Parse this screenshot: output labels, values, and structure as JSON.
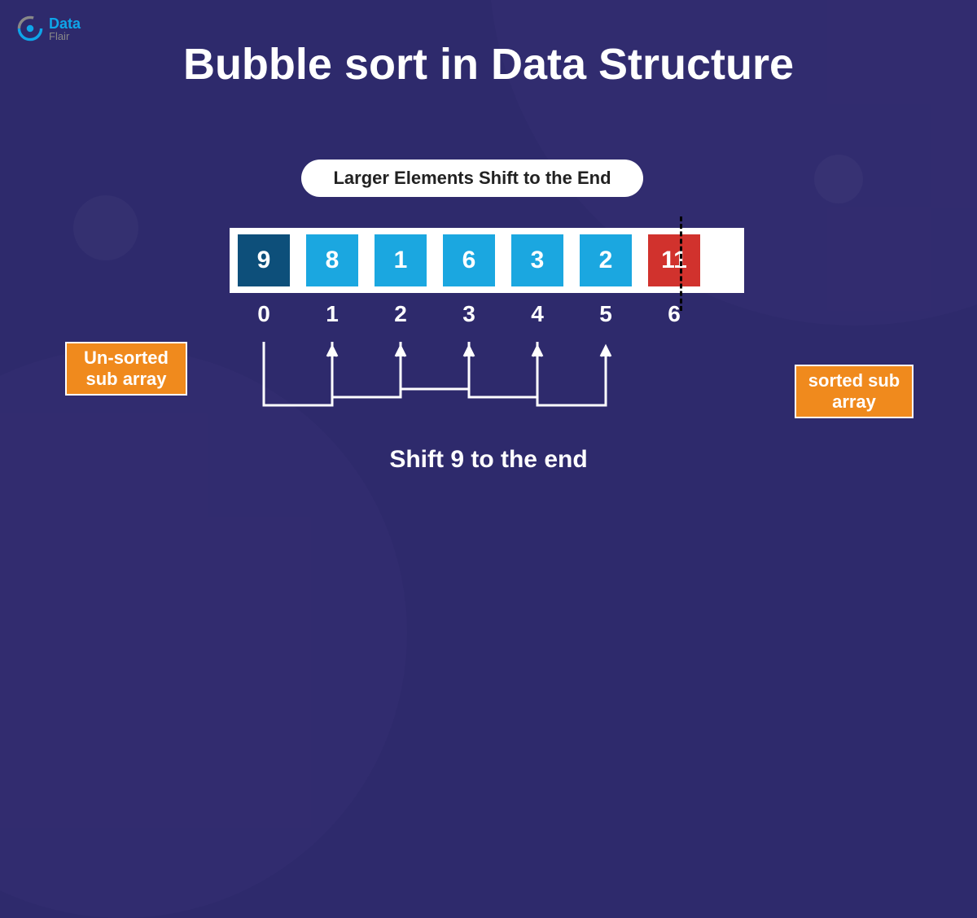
{
  "logo": {
    "top": "Data",
    "bottom": "Flair"
  },
  "title": "Bubble sort in Data Structure",
  "pill_text": "Larger Elements Shift to the End",
  "array": [
    {
      "value": "9",
      "style": "dark"
    },
    {
      "value": "8",
      "style": "blue"
    },
    {
      "value": "1",
      "style": "blue"
    },
    {
      "value": "6",
      "style": "blue"
    },
    {
      "value": "3",
      "style": "blue"
    },
    {
      "value": "2",
      "style": "blue"
    },
    {
      "value": "11",
      "style": "red"
    }
  ],
  "indices": [
    "0",
    "1",
    "2",
    "3",
    "4",
    "5",
    "6"
  ],
  "unsorted_label": "Un-sorted sub array",
  "sorted_label": "sorted sub array",
  "bottom_caption": "Shift 9 to the end"
}
